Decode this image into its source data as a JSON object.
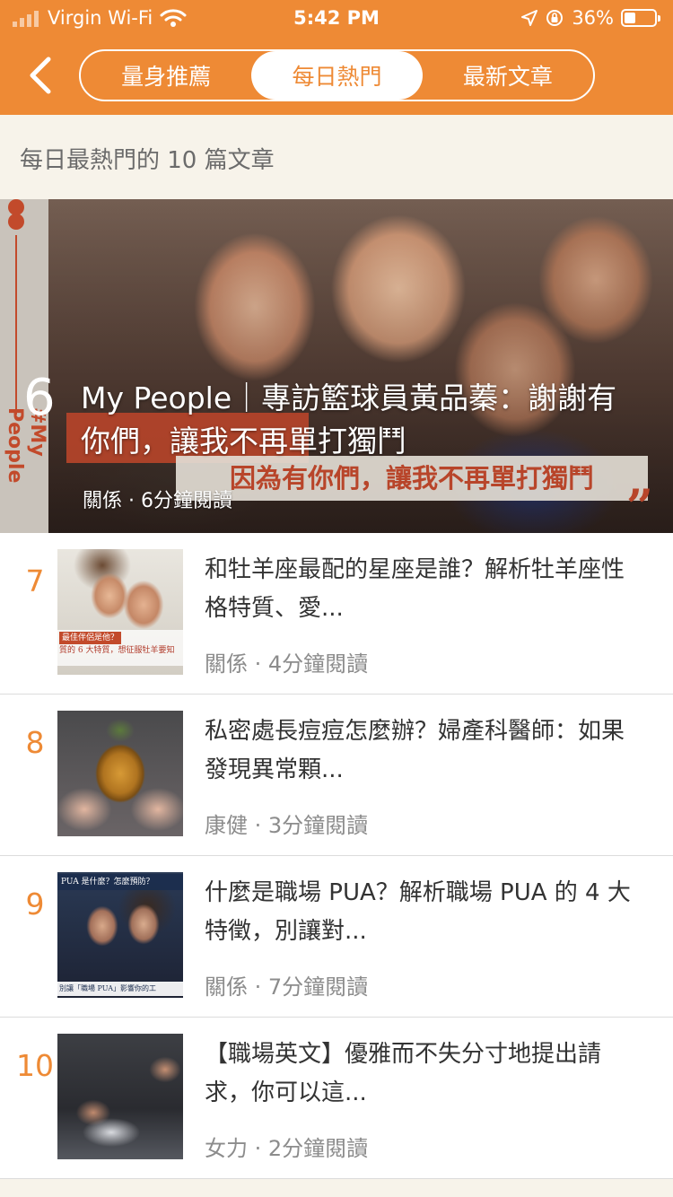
{
  "status_bar": {
    "carrier": "Virgin Wi-Fi",
    "time": "5:42 PM",
    "battery": "36%",
    "battery_level": 0.36
  },
  "header": {
    "tabs": [
      {
        "label": "量身推薦",
        "active": false
      },
      {
        "label": "每日熱門",
        "active": true
      },
      {
        "label": "最新文章",
        "active": false
      }
    ],
    "accent_color": "#ee8a35"
  },
  "subtitle": "每日最熱門的 10 篇文章",
  "featured": {
    "rank": "6",
    "title": "My People｜專訪籃球員黃品蓁：謝謝有你們，讓我不再單打獨鬥",
    "meta": "關係 · 6分鐘閱讀",
    "image_overlay": {
      "side_tag": "#My People",
      "quote": "因為有你們，讓我不再單打獨鬥",
      "quote_mark": "”"
    }
  },
  "articles": [
    {
      "rank": "7",
      "title": "和牡羊座最配的星座是誰？解析牡羊座性格特質、愛...",
      "meta": "關係 · 4分鐘閱讀",
      "thumb_caption_1": "最佳伴侶是他？",
      "thumb_caption_2": "質的 6 大特質，想征服牡羊要知"
    },
    {
      "rank": "8",
      "title": "私密處長痘痘怎麼辦？婦產科醫師：如果發現異常顆...",
      "meta": "康健 · 3分鐘閱讀"
    },
    {
      "rank": "9",
      "title": "什麼是職場 PUA？解析職場 PUA 的 4 大特徵，別讓對...",
      "meta": "關係 · 7分鐘閱讀",
      "thumb_caption_1": "PUA 是什麼？怎麼預防？",
      "thumb_caption_2": "別讓「職場 PUA」影響你的工"
    },
    {
      "rank": "10",
      "title": "【職場英文】優雅而不失分寸地提出請求，你可以這...",
      "meta": "女力 · 2分鐘閱讀"
    }
  ]
}
